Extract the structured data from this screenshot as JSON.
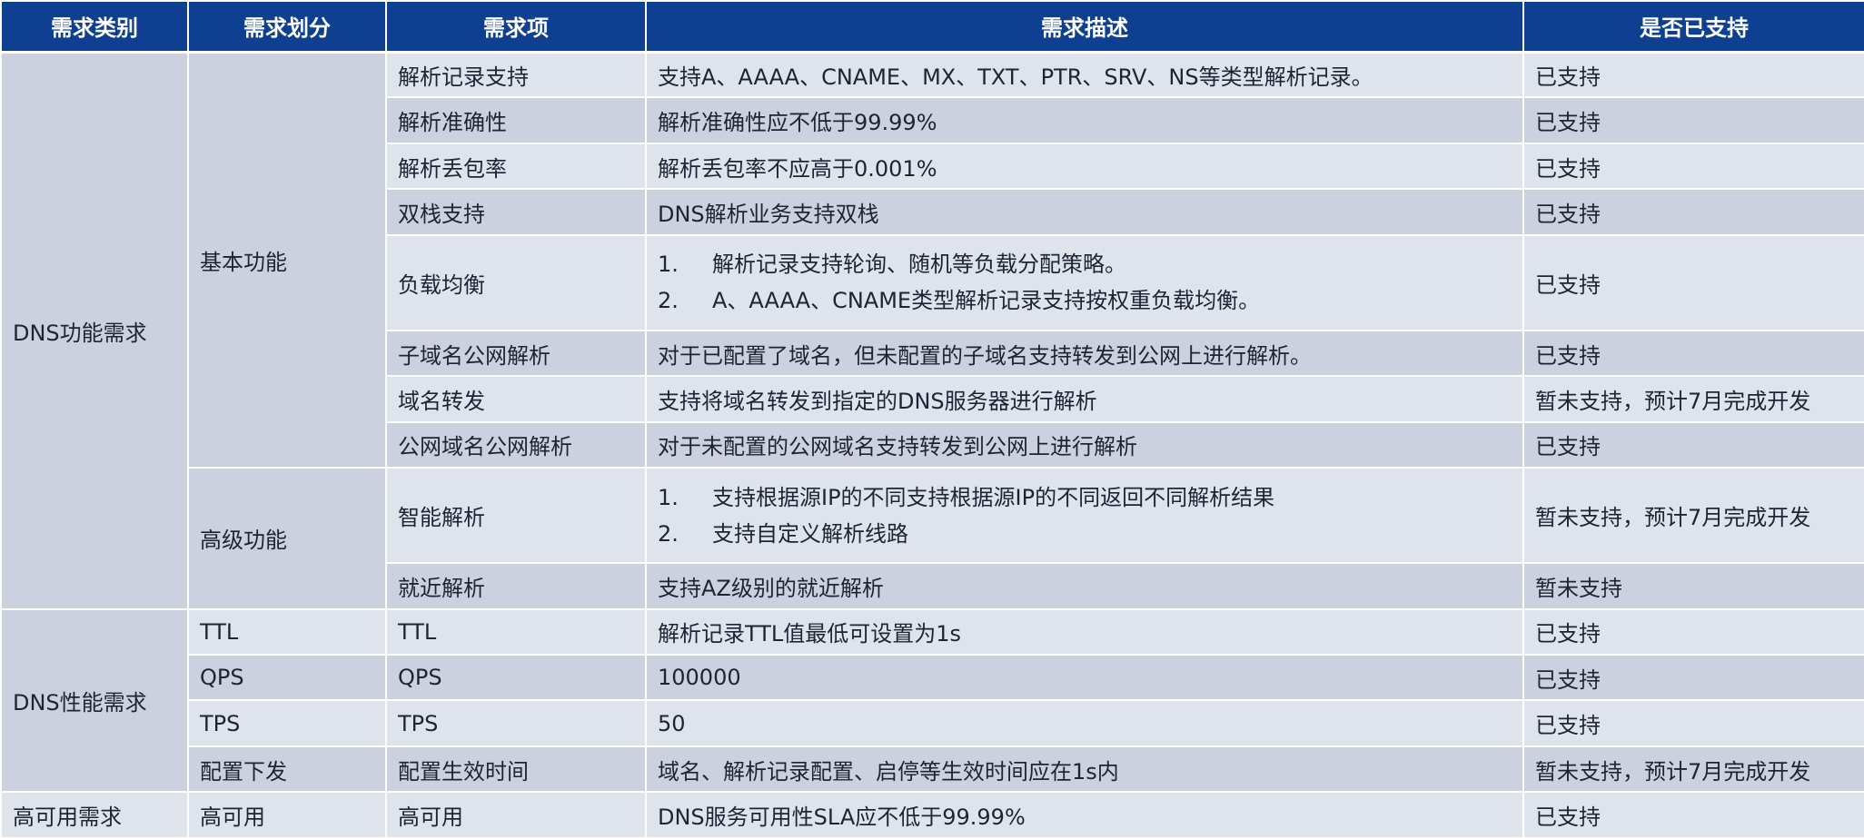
{
  "header": [
    "需求类别",
    "需求划分",
    "需求项",
    "需求描述",
    "是否已支持"
  ],
  "groups": {
    "dns_function": "DNS功能需求",
    "dns_performance": "DNS性能需求",
    "high_availability": "高可用需求"
  },
  "subgroups": {
    "basic": "基本功能",
    "advanced": "高级功能",
    "ttl": "TTL",
    "qps": "QPS",
    "tps": "TPS",
    "config_push": "配置下发",
    "ha": "高可用"
  },
  "rows": [
    {
      "item": "解析记录支持",
      "desc": [
        "支持A、AAAA、CNAME、MX、TXT、PTR、SRV、NS等类型解析记录。"
      ],
      "status": "已支持"
    },
    {
      "item": "解析准确性",
      "desc": [
        "解析准确性应不低于99.99%"
      ],
      "status": "已支持"
    },
    {
      "item": "解析丢包率",
      "desc": [
        "解析丢包率不应高于0.001%"
      ],
      "status": "已支持"
    },
    {
      "item": "双栈支持",
      "desc": [
        "DNS解析业务支持双栈"
      ],
      "status": "已支持"
    },
    {
      "item": "负载均衡",
      "desc_nums": [
        "1.",
        "2."
      ],
      "desc": [
        "解析记录支持轮询、随机等负载分配策略。",
        "A、AAAA、CNAME类型解析记录支持按权重负载均衡。"
      ],
      "status": "已支持"
    },
    {
      "item": "子域名公网解析",
      "desc": [
        "对于已配置了域名，但未配置的子域名支持转发到公网上进行解析。"
      ],
      "status": "已支持"
    },
    {
      "item": "域名转发",
      "desc": [
        "支持将域名转发到指定的DNS服务器进行解析"
      ],
      "status": "暂未支持，预计7月完成开发"
    },
    {
      "item": "公网域名公网解析",
      "desc": [
        "对于未配置的公网域名支持转发到公网上进行解析"
      ],
      "status": "已支持"
    },
    {
      "item": "智能解析",
      "desc_nums": [
        "1.",
        "2."
      ],
      "desc": [
        "支持根据源IP的不同支持根据源IP的不同返回不同解析结果",
        "支持自定义解析线路"
      ],
      "status": "暂未支持，预计7月完成开发"
    },
    {
      "item": "就近解析",
      "desc": [
        "支持AZ级别的就近解析"
      ],
      "status": "暂未支持"
    },
    {
      "item": "TTL",
      "desc": [
        "解析记录TTL值最低可设置为1s"
      ],
      "status": "已支持"
    },
    {
      "item": "QPS",
      "desc": [
        "100000"
      ],
      "status": "已支持"
    },
    {
      "item": "TPS",
      "desc": [
        "50"
      ],
      "status": "已支持"
    },
    {
      "item": "配置生效时间",
      "desc": [
        "域名、解析记录配置、启停等生效时间应在1s内"
      ],
      "status": "暂未支持，预计7月完成开发"
    },
    {
      "item": "高可用",
      "desc": [
        "DNS服务可用性SLA应不低于99.99%"
      ],
      "status": "已支持"
    }
  ]
}
